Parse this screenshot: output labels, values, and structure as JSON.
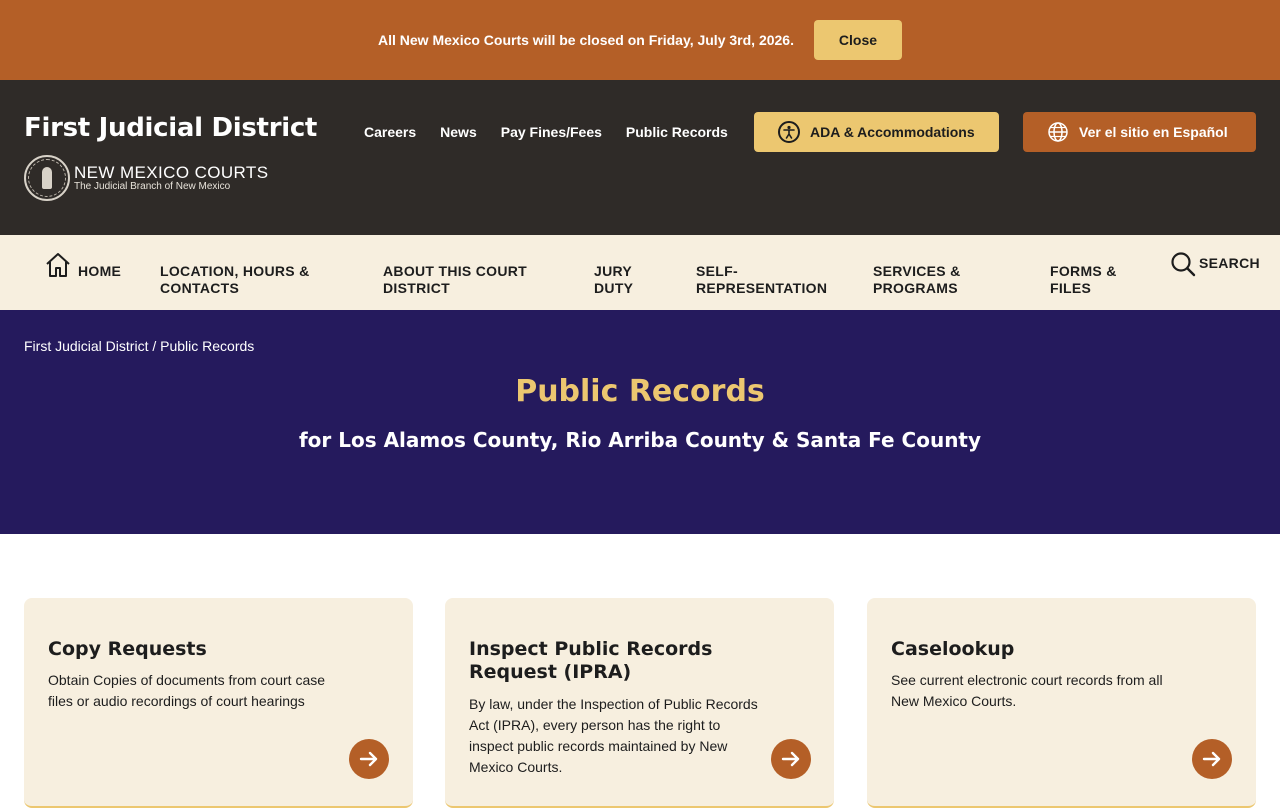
{
  "alert": {
    "message": "All New Mexico Courts will be closed on Friday, July 3rd, 2026.",
    "close_label": "Close"
  },
  "header": {
    "site_title": "First Judicial District",
    "brand_name": "NEW MEXICO COURTS",
    "brand_tagline": "The Judicial Branch of New Mexico",
    "nav": [
      "Careers",
      "News",
      "Pay Fines/Fees",
      "Public Records"
    ],
    "ada_label": "ADA & Accommodations",
    "spanish_label": "Ver el sitio en Español"
  },
  "mainnav": {
    "home": "HOME",
    "location_1": "LOCATION, HOURS &",
    "location_2": "CONTACTS",
    "about_1": "ABOUT THIS COURT",
    "about_2": "DISTRICT",
    "jury_1": "JURY",
    "jury_2": "DUTY",
    "self_1": "SELF-",
    "self_2": "REPRESENTATION",
    "services_1": "SERVICES &",
    "services_2": "PROGRAMS",
    "forms_1": "FORMS &",
    "forms_2": "FILES",
    "search": "SEARCH"
  },
  "hero": {
    "breadcrumb_root": "First Judicial District",
    "breadcrumb_sep": " / ",
    "breadcrumb_current": "Public Records",
    "title": "Public Records",
    "subtitle": "for Los Alamos County, Rio Arriba County & Santa Fe County"
  },
  "cards": [
    {
      "title": "Copy Requests",
      "description": "Obtain Copies of documents from court case files or audio recordings of court hearings"
    },
    {
      "title": "Inspect Public Records Request (IPRA)",
      "description": "By law, under the Inspection of Public Records Act (IPRA), every person has the right to inspect public records maintained by New Mexico Courts."
    },
    {
      "title": "Caselookup",
      "description": "See current electronic court records from all New Mexico Courts."
    }
  ],
  "colors": {
    "accent_orange": "#b45f27",
    "accent_gold": "#ecc770",
    "header_dark": "#2f2b28",
    "hero_purple": "#251a5d",
    "cream": "#f7efdf"
  }
}
